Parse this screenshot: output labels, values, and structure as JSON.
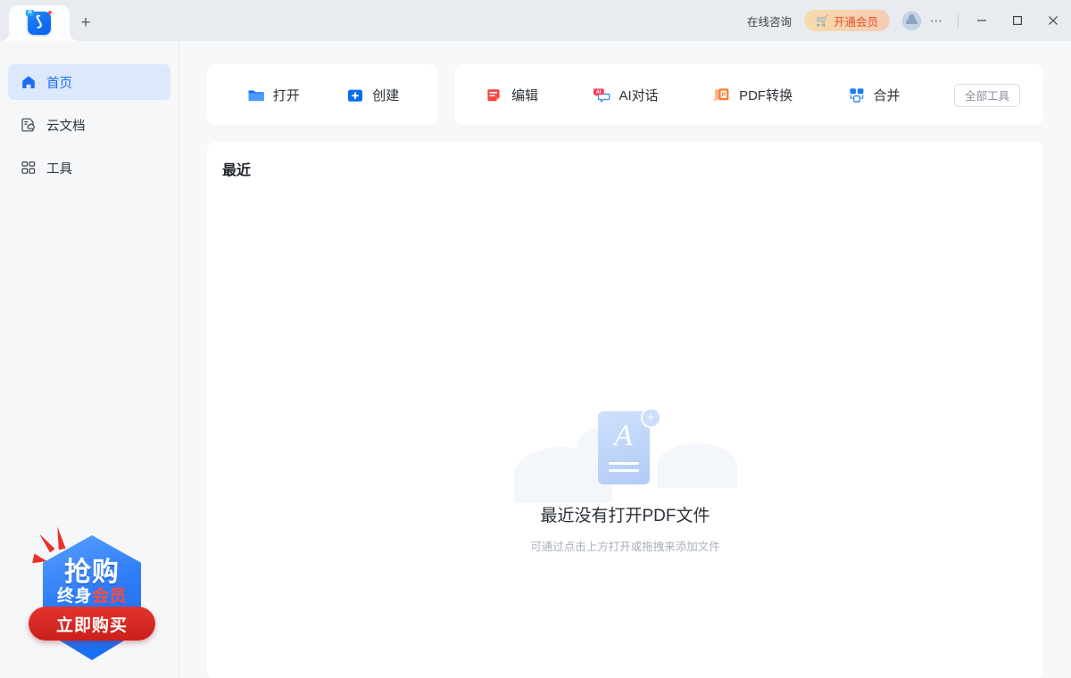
{
  "titlebar": {
    "app_icon_name": "app-logo-icon",
    "ai_badge": "AI",
    "new_tab_label": "+",
    "online_consult": "在线咨询",
    "vip_button": "开通会员",
    "cart_icon": "cart-icon",
    "more_dots": "⋯",
    "minimize": "—",
    "maximize": "▢",
    "close": "✕"
  },
  "sidebar": {
    "items": [
      {
        "label": "首页",
        "icon": "home-icon",
        "active": true
      },
      {
        "label": "云文档",
        "icon": "cloud-doc-icon",
        "active": false
      },
      {
        "label": "工具",
        "icon": "grid-tools-icon",
        "active": false
      }
    ]
  },
  "quick_actions_primary": [
    {
      "label": "打开",
      "icon": "folder-open-icon"
    },
    {
      "label": "创建",
      "icon": "plus-square-icon"
    }
  ],
  "quick_actions_secondary": [
    {
      "label": "编辑",
      "icon": "edit-doc-icon"
    },
    {
      "label": "AI对话",
      "icon": "ai-chat-icon"
    },
    {
      "label": "PDF转换",
      "icon": "pdf-convert-icon"
    },
    {
      "label": "合并",
      "icon": "merge-icon"
    }
  ],
  "all_tools_button": "全部工具",
  "recent": {
    "title": "最近",
    "empty_title": "最近没有打开PDF文件",
    "empty_subtitle": "可通过点击上方打开或拖拽来添加文件",
    "empty_icon": "pdf-add-icon"
  },
  "promo": {
    "line1": "抢购",
    "line2_white": "终身",
    "line2_red": "会员",
    "button": "立即购买"
  },
  "colors": {
    "accent_blue": "#1a6ef5",
    "sidebar_active_bg": "#dce8fb",
    "vip_text": "#e8512a",
    "promo_red": "#e4332d",
    "titlebar_bg": "#e8ecf1",
    "canvas_bg": "#f6f8fa"
  }
}
